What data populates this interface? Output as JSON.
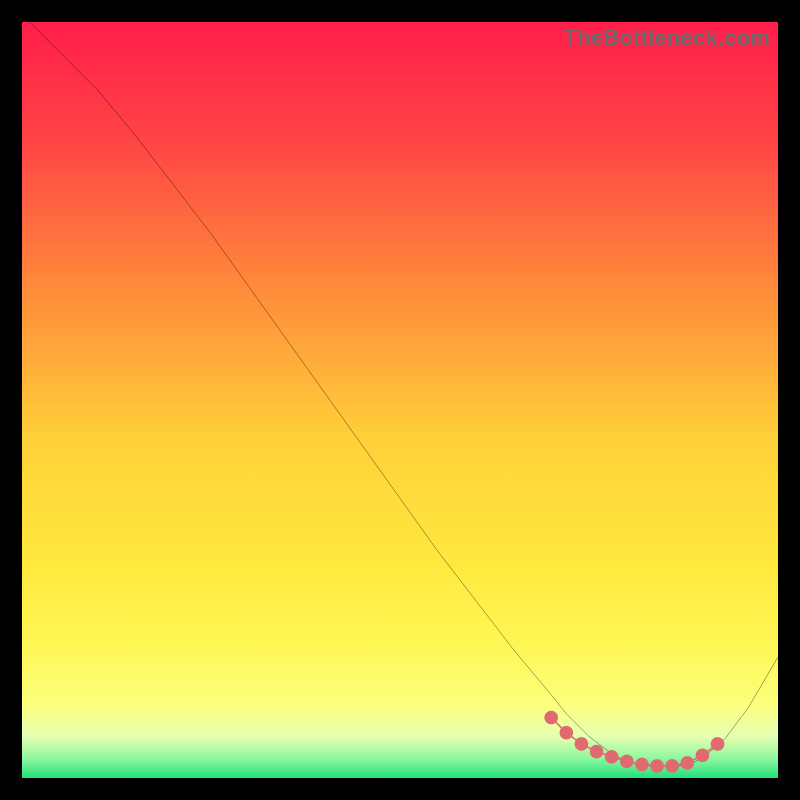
{
  "watermark": "TheBottleneck.com",
  "chart_data": {
    "type": "line",
    "title": "",
    "xlabel": "",
    "ylabel": "",
    "xlim": [
      0,
      100
    ],
    "ylim": [
      0,
      100
    ],
    "grid": false,
    "legend": false,
    "gradient_stops": [
      {
        "offset": 0.0,
        "color": "#ff1e4b"
      },
      {
        "offset": 0.15,
        "color": "#ff4245"
      },
      {
        "offset": 0.35,
        "color": "#ff8a3a"
      },
      {
        "offset": 0.55,
        "color": "#ffd039"
      },
      {
        "offset": 0.72,
        "color": "#ffe93e"
      },
      {
        "offset": 0.82,
        "color": "#fff654"
      },
      {
        "offset": 0.9,
        "color": "#fcff7a"
      },
      {
        "offset": 0.945,
        "color": "#e6ffb0"
      },
      {
        "offset": 0.975,
        "color": "#8cf79e"
      },
      {
        "offset": 1.0,
        "color": "#22e07a"
      }
    ],
    "series": [
      {
        "name": "bottleneck-curve",
        "color": "#000000",
        "x": [
          1,
          5,
          10,
          15,
          20,
          25,
          30,
          35,
          40,
          45,
          50,
          55,
          60,
          65,
          70,
          72,
          75,
          78,
          80,
          83,
          86,
          88,
          90,
          93,
          96,
          100
        ],
        "y": [
          100,
          96,
          91,
          85,
          78.5,
          72,
          65,
          58,
          51,
          44,
          37,
          30,
          23.5,
          17,
          11,
          8.5,
          5.5,
          3.2,
          2.2,
          1.6,
          1.5,
          1.7,
          2.6,
          5.2,
          9.2,
          16
        ]
      }
    ],
    "markers": {
      "name": "minimum-band",
      "color": "#e06a6f",
      "points_x": [
        70,
        72,
        74,
        76,
        78,
        80,
        82,
        84,
        86,
        88,
        90,
        92
      ],
      "points_y": [
        8.0,
        6.0,
        4.5,
        3.5,
        2.8,
        2.2,
        1.8,
        1.6,
        1.6,
        2.0,
        3.0,
        4.5
      ]
    }
  }
}
